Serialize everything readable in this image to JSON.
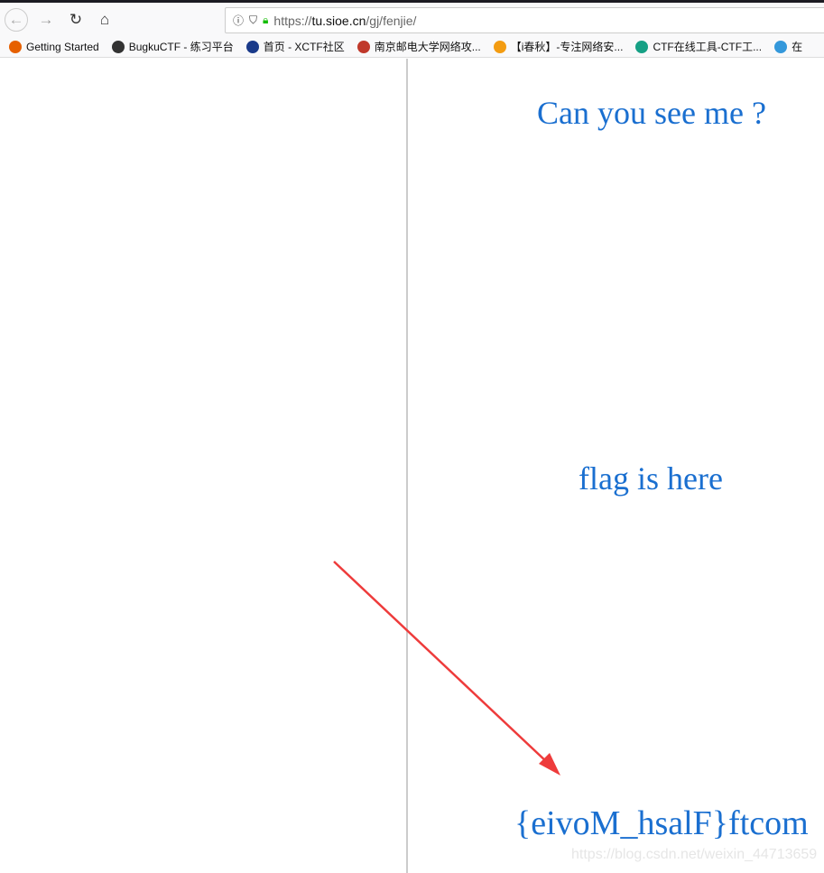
{
  "browser": {
    "url_scheme": "https://",
    "url_host": "tu.sioe.cn",
    "url_path": "/gj/fenjie/",
    "bookmarks": [
      {
        "label": "Getting Started",
        "icon": "firefox-icon",
        "color": "#e66000"
      },
      {
        "label": "BugkuCTF - 练习平台",
        "icon": "flag-icon",
        "color": "#333333"
      },
      {
        "label": "首页 - XCTF社区",
        "icon": "xctf-icon",
        "color": "#1a3a8a"
      },
      {
        "label": "南京邮电大学网络攻...",
        "icon": "njupt-icon",
        "color": "#c0392b"
      },
      {
        "label": "【i春秋】-专注网络安...",
        "icon": "ichunqiu-icon",
        "color": "#f39c12"
      },
      {
        "label": "CTF在线工具-CTF工...",
        "icon": "ctftools-icon",
        "color": "#16a085"
      },
      {
        "label": "在",
        "icon": "cloud-icon",
        "color": "#3498db"
      }
    ]
  },
  "page": {
    "title": "Can you see me ?",
    "hint": "flag is here",
    "flag": "{eivoM_hsalF}ftcom",
    "text_color": "#1a6fd0",
    "arrow_color": "#ee3b3b"
  },
  "watermark": "https://blog.csdn.net/weixin_44713659"
}
